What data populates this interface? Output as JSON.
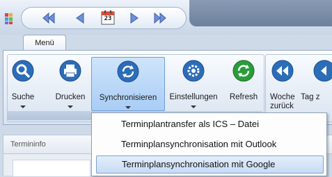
{
  "tab": {
    "label": "Menü"
  },
  "quick_access": {
    "buttons": [
      {
        "icon": "double-left-arrow-icon"
      },
      {
        "icon": "left-arrow-icon"
      },
      {
        "icon": "calendar-icon",
        "text": "23"
      },
      {
        "icon": "right-arrow-icon"
      },
      {
        "icon": "double-right-arrow-icon"
      }
    ]
  },
  "ribbon": {
    "buttons": [
      {
        "label": "Suche",
        "icon": "search-icon"
      },
      {
        "label": "Drucken",
        "icon": "printer-icon"
      },
      {
        "label": "Synchronisieren",
        "icon": "sync-icon"
      },
      {
        "label": "Einstellungen",
        "icon": "gear-icon"
      },
      {
        "label": "Refresh",
        "icon": "refresh-icon"
      },
      {
        "label": "Woche zurück",
        "icon": "rewind-icon"
      },
      {
        "label": "Tag z",
        "icon": "back-icon"
      }
    ]
  },
  "info_bar": {
    "label": "Termininfo"
  },
  "dropdown": {
    "items": [
      {
        "label": "Terminplantransfer als ICS – Datei"
      },
      {
        "label": "Terminplansynchronisation mit Outlook"
      },
      {
        "label": "Terminplansynchronisation mit  Google"
      }
    ]
  },
  "colors": {
    "ribbon_blue": "#2c6db8",
    "refresh_green": "#2a9d3a",
    "highlight": "#c7dbf5"
  }
}
